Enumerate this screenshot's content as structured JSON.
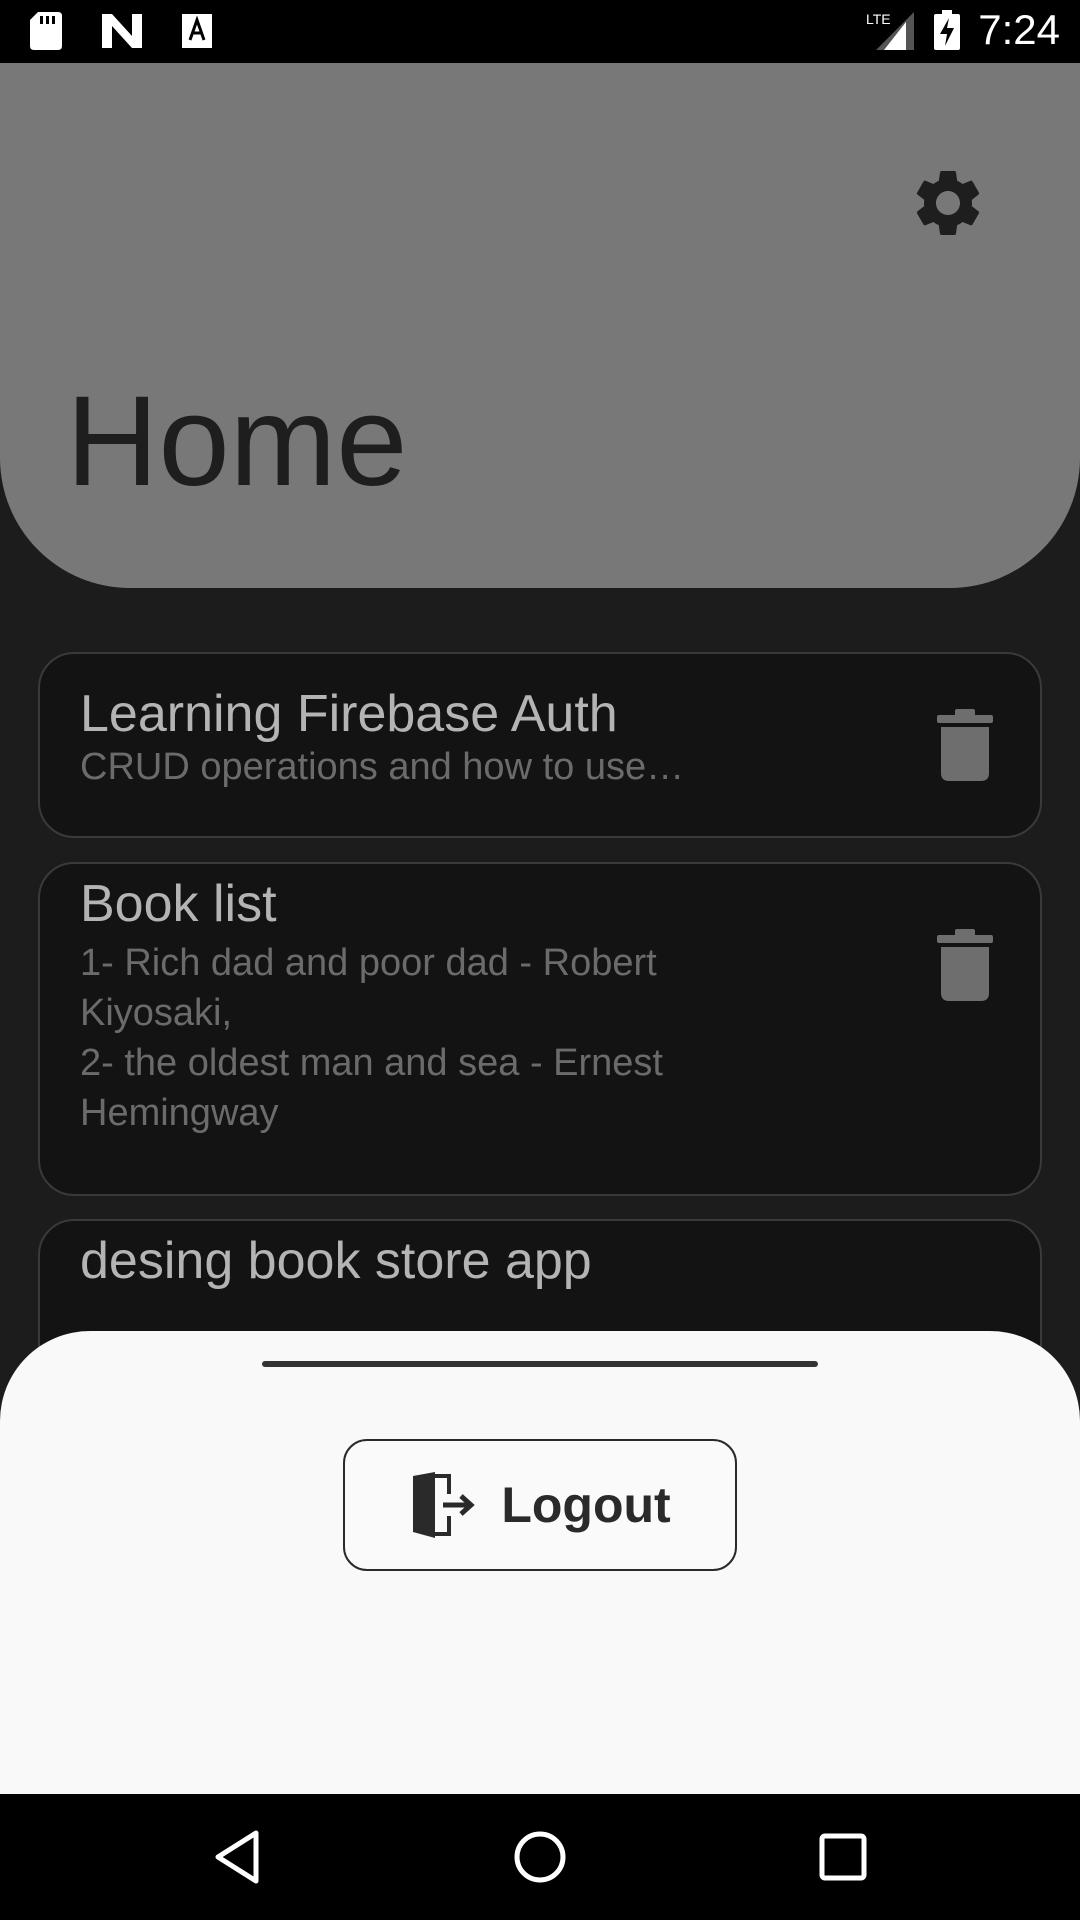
{
  "status_bar": {
    "time": "7:24",
    "network": "LTE",
    "left_icons": [
      "sd-card-icon",
      "n-logo-icon",
      "font-a-icon"
    ],
    "right_icons": [
      "signal-icon",
      "battery-charging-icon"
    ]
  },
  "header": {
    "title": "Home",
    "settings_icon": "gear-icon",
    "background": "#787878"
  },
  "notes": [
    {
      "title": "Learning Firebase Auth",
      "body": "CRUD operations and how to use…",
      "delete_icon": "trash-icon"
    },
    {
      "title": "Book list",
      "body": "1- Rich dad and poor dad - Robert\nKiyosaki,\n2- the oldest man and sea - Ernest\nHemingway",
      "delete_icon": "trash-icon"
    },
    {
      "title": "desing book store app",
      "body": "",
      "delete_icon": "trash-icon"
    }
  ],
  "bottom_sheet": {
    "logout_label": "Logout",
    "logout_icon": "exit-door-icon"
  },
  "nav_bar": {
    "buttons": [
      "back-icon",
      "home-icon",
      "recents-icon"
    ]
  },
  "colors": {
    "app_background": "#1c1c1c",
    "card_background": "#131313",
    "sheet_background": "#f9f9f9"
  }
}
